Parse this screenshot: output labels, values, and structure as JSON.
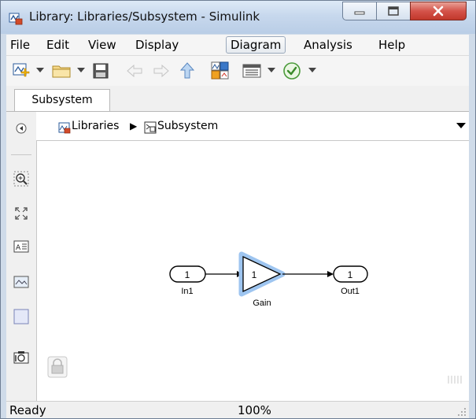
{
  "window": {
    "title": "Library: Libraries/Subsystem - Simulink"
  },
  "menu": {
    "items": [
      {
        "label": "File"
      },
      {
        "label": "Edit"
      },
      {
        "label": "View"
      },
      {
        "label": "Display"
      },
      {
        "label": "Diagram",
        "active": true
      },
      {
        "label": "Analysis"
      },
      {
        "label": "Help"
      }
    ]
  },
  "toolbar": {
    "icons": [
      "new-model-icon",
      "open-folder-icon",
      "save-icon",
      "back-arrow-icon",
      "forward-arrow-icon",
      "up-arrow-icon",
      "library-browser-icon",
      "model-explorer-icon",
      "check-icon"
    ]
  },
  "tab": {
    "label": "Subsystem"
  },
  "breadcrumb": {
    "root": "Libraries",
    "separator": "▶",
    "current": "Subsystem"
  },
  "diagram": {
    "inport": {
      "number": "1",
      "label": "In1"
    },
    "gain": {
      "value": "1",
      "label": "Gain"
    },
    "outport": {
      "number": "1",
      "label": "Out1"
    }
  },
  "status": {
    "left": "Ready",
    "zoom": "100%"
  },
  "colors": {
    "selection_glow": "#9ec5f0",
    "title_gradient_top": "#dde9f7",
    "close_button": "#c7433a"
  }
}
